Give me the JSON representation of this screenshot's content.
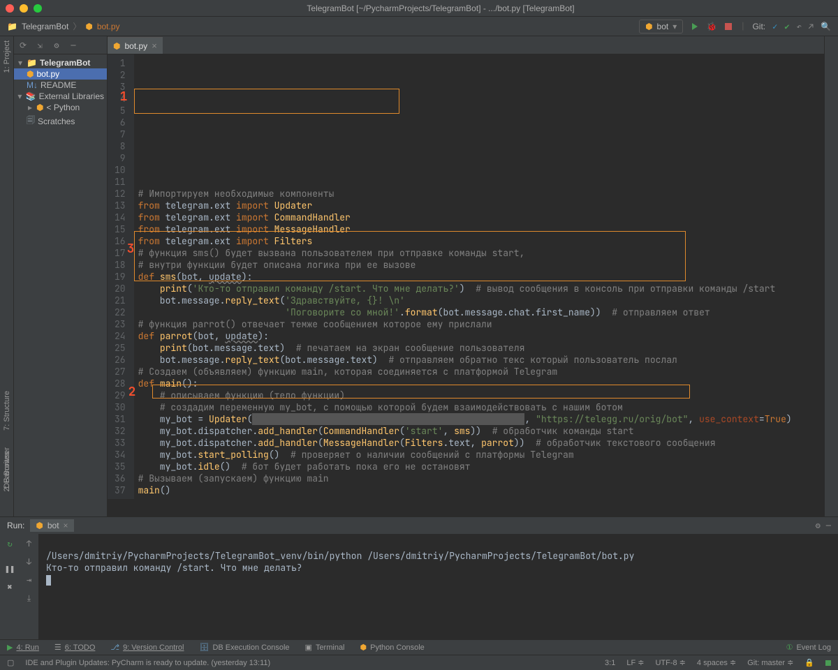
{
  "window": {
    "title": "TelegramBot [~/PycharmProjects/TelegramBot] - .../bot.py [TelegramBot]"
  },
  "breadcrumb": {
    "project": "TelegramBot",
    "file": "bot.py"
  },
  "run_config": {
    "label": "bot"
  },
  "git": {
    "label": "Git:"
  },
  "leftrail": {
    "project": "1: Project",
    "db": "DB Browser"
  },
  "right_tabs": {
    "structure": "7: Structure",
    "favorites": "2: Favorites"
  },
  "tree": {
    "root": "TelegramBot",
    "file1": "bot.py",
    "file2": "README",
    "ext": "External Libraries",
    "python": "< Python",
    "scratch": "Scratches"
  },
  "tab": {
    "name": "bot.py"
  },
  "code_lines": [
    "# Импортируем необходимые компоненты",
    "from telegram.ext import Updater",
    "from telegram.ext import CommandHandler",
    "from telegram.ext import MessageHandler",
    "from telegram.ext import Filters",
    "",
    "",
    "# функция sms() будет вызвана пользователем при отправке команды start,",
    "# внутри функции будет описана логика при ее вызове",
    "def sms(bot, update):",
    "    print('Кто-то отправил команду /start. Что мне делать?')  # вывод сообщения в консоль при отправки команды /start",
    "    bot.message.reply_text('Здравствуйте, {}! \\n'",
    "                           'Поговорите со мной!'.format(bot.message.chat.first_name))  # отправляем ответ",
    "",
    "",
    "# функция parrot() отвечает темже сообщением которое ему прислали",
    "def parrot(bot, update):",
    "    print(bot.message.text)  # печатаем на экран сообщение пользователя",
    "    bot.message.reply_text(bot.message.text)  # отправляем обратно текс который пользователь послал",
    "",
    "",
    "# Создаем (объявляем) функцию main, которая соединяется с платформой Telegram",
    "def main():",
    "    # описываем функцию (тело функции)",
    "    # создадим переменную my_bot, с помощью которой будем взаимодействовать с нашим ботом",
    "    my_bot = Updater(\"                                                \", \"https://telegg.ru/orig/bot\", use_context=True)",
    "    my_bot.dispatcher.add_handler(CommandHandler('start', sms))  # обработчик команды start",
    "",
    "    my_bot.dispatcher.add_handler(MessageHandler(Filters.text, parrot))  # обработчик текстового сообщения",
    "",
    "    my_bot.start_polling()  # проверяет о наличии сообщений с платформы Telegram",
    "    my_bot.idle()  # бот будет работать пока его не остановят",
    "",
    "",
    "# Вызываем (запускаем) функцию main",
    "main()",
    ""
  ],
  "markers": {
    "m1": "1",
    "m2": "2",
    "m3": "3"
  },
  "run": {
    "label": "Run:",
    "tab": "bot",
    "line1": "/Users/dmitriy/PycharmProjects/TelegramBot_venv/bin/python /Users/dmitriy/PycharmProjects/TelegramBot/bot.py",
    "line2": "Кто-то отправил команду /start. Что мне делать?"
  },
  "toolstrip": {
    "run": "4: Run",
    "todo": "6: TODO",
    "vcs": "9: Version Control",
    "db": "DB Execution Console",
    "terminal": "Terminal",
    "pycon": "Python Console",
    "eventlog": "Event Log"
  },
  "status": {
    "msg": "IDE and Plugin Updates: PyCharm is ready to update. (yesterday 13:11)",
    "pos": "3:1",
    "lf": "LF",
    "enc": "UTF-8",
    "indent": "4 spaces",
    "git": "Git: master",
    "lock": "🔒"
  }
}
